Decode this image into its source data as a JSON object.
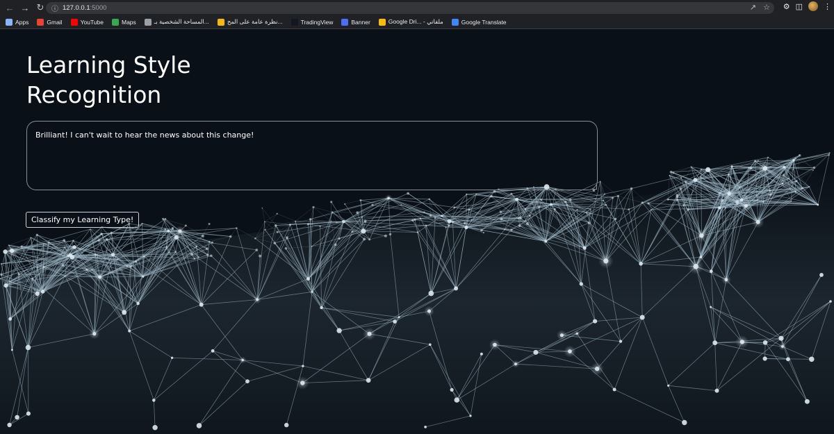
{
  "browser": {
    "url_host": "127.0.0.1",
    "url_port": ":5000",
    "bookmarks": [
      {
        "label": "Apps",
        "icon": "apps-grid-icon",
        "color": "#8ab4f8"
      },
      {
        "label": "Gmail",
        "icon": "gmail-icon",
        "color": "#ea4335"
      },
      {
        "label": "YouTube",
        "icon": "youtube-icon",
        "color": "#ff0000"
      },
      {
        "label": "Maps",
        "icon": "maps-icon",
        "color": "#34a853"
      },
      {
        "label": "المساحة الشخصية بـ...",
        "icon": "globe-icon",
        "color": "#9aa0a6"
      },
      {
        "label": "نظرة عامة على المح...",
        "icon": "binance-icon",
        "color": "#f0b90b"
      },
      {
        "label": "TradingView",
        "icon": "tradingview-icon",
        "color": "#131722"
      },
      {
        "label": "Banner",
        "icon": "banner-icon",
        "color": "#4c6ef5"
      },
      {
        "label": "Google Dri... - ملفاتي",
        "icon": "google-drive-icon",
        "color": "#fbbc04"
      },
      {
        "label": "Google Translate",
        "icon": "google-translate-icon",
        "color": "#4285f4"
      }
    ]
  },
  "main": {
    "title": "Learning Style Recognition",
    "input_text": "Brilliant! I can't wait to hear the news about this change!",
    "classify_label": "Classify my Learning Type!"
  },
  "colors": {
    "background": "#0a1017",
    "network_line": "#9fb7c4",
    "text": "#ffffff"
  }
}
